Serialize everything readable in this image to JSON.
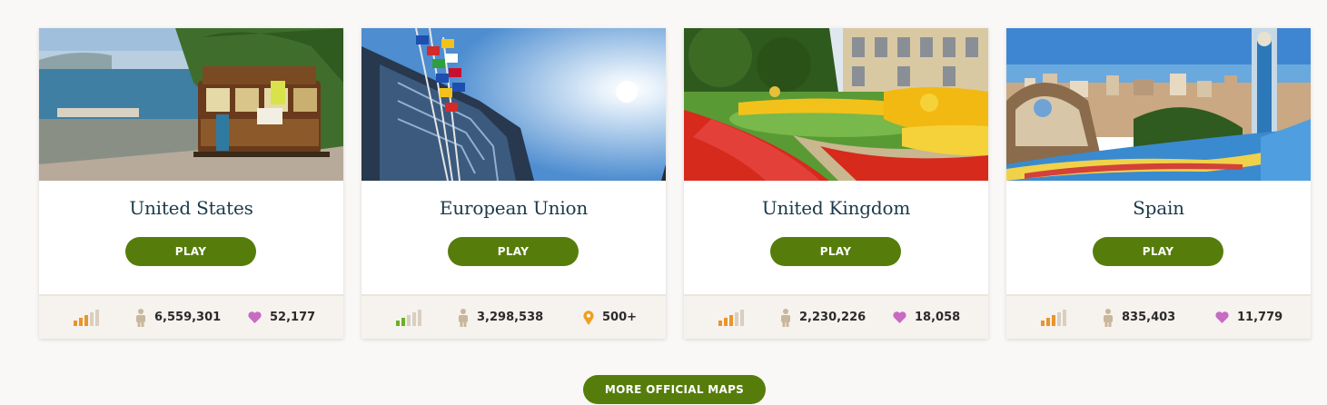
{
  "cards": [
    {
      "title": "United States",
      "play_label": "PLAY",
      "difficulty_level": 3,
      "difficulty_color": "#e8952a",
      "plays": "6,559,301",
      "third_icon": "heart-icon",
      "third_value": "52,177"
    },
    {
      "title": "European Union",
      "play_label": "PLAY",
      "difficulty_level": 2,
      "difficulty_color": "#6ab023",
      "plays": "3,298,538",
      "third_icon": "map-pin-icon",
      "third_value": "500+"
    },
    {
      "title": "United Kingdom",
      "play_label": "PLAY",
      "difficulty_level": 3,
      "difficulty_color": "#e8952a",
      "plays": "2,230,226",
      "third_icon": "heart-icon",
      "third_value": "18,058"
    },
    {
      "title": "Spain",
      "play_label": "PLAY",
      "difficulty_level": 3,
      "difficulty_color": "#e8952a",
      "plays": "835,403",
      "third_icon": "heart-icon",
      "third_value": "11,779"
    }
  ],
  "more_button_label": "MORE OFFICIAL MAPS",
  "colors": {
    "accent_green": "#567d0b",
    "title_color": "#1a3a4a",
    "heart": "#c76bc4",
    "pin": "#f0a020",
    "person": "#c9b79c",
    "bar_inactive": "#d9cfc0"
  }
}
